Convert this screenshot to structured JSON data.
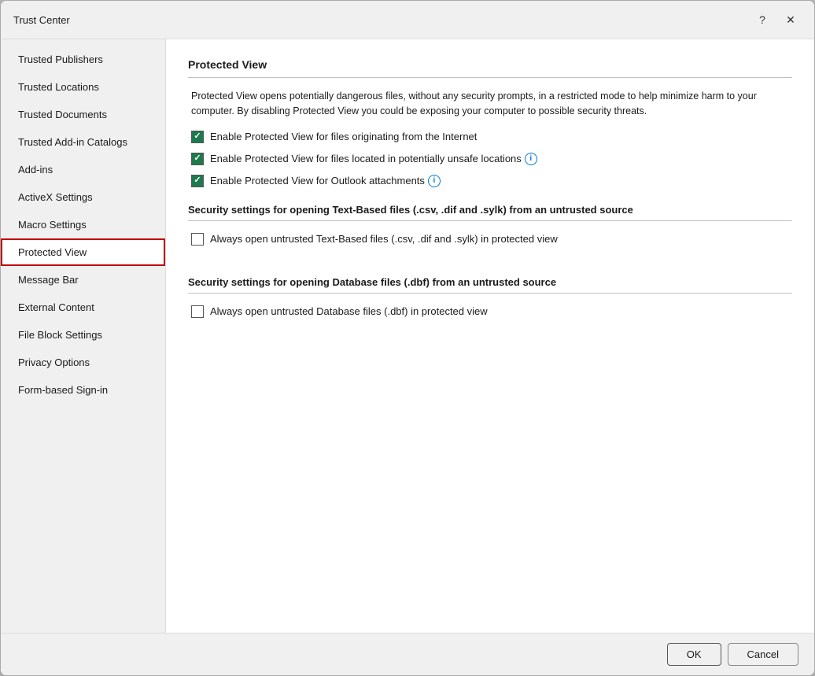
{
  "dialog": {
    "title": "Trust Center",
    "help_btn": "?",
    "close_btn": "✕"
  },
  "sidebar": {
    "items": [
      {
        "id": "trusted-publishers",
        "label": "Trusted Publishers",
        "active": false
      },
      {
        "id": "trusted-locations",
        "label": "Trusted Locations",
        "active": false
      },
      {
        "id": "trusted-documents",
        "label": "Trusted Documents",
        "active": false
      },
      {
        "id": "trusted-add-in-catalogs",
        "label": "Trusted Add-in Catalogs",
        "active": false
      },
      {
        "id": "add-ins",
        "label": "Add-ins",
        "active": false
      },
      {
        "id": "activex-settings",
        "label": "ActiveX Settings",
        "active": false
      },
      {
        "id": "macro-settings",
        "label": "Macro Settings",
        "active": false
      },
      {
        "id": "protected-view",
        "label": "Protected View",
        "active": true
      },
      {
        "id": "message-bar",
        "label": "Message Bar",
        "active": false
      },
      {
        "id": "external-content",
        "label": "External Content",
        "active": false
      },
      {
        "id": "file-block-settings",
        "label": "File Block Settings",
        "active": false
      },
      {
        "id": "privacy-options",
        "label": "Privacy Options",
        "active": false
      },
      {
        "id": "form-based-sign-in",
        "label": "Form-based Sign-in",
        "active": false
      }
    ]
  },
  "main": {
    "page_title": "Protected View",
    "description": "Protected View opens potentially dangerous files, without any security prompts, in a restricted mode to help minimize harm to your computer. By disabling Protected View you could be exposing your computer to possible security threats.",
    "checkboxes": [
      {
        "id": "cb-internet",
        "checked": true,
        "label": "Enable Protected View for files originating from the Internet",
        "has_info": false
      },
      {
        "id": "cb-unsafe-locations",
        "checked": true,
        "label": "Enable Protected View for files located in potentially unsafe locations",
        "has_info": true
      },
      {
        "id": "cb-outlook",
        "checked": true,
        "label": "Enable Protected View for Outlook attachments",
        "has_info": true
      }
    ],
    "text_based_section": {
      "title": "Security settings for opening Text-Based files (.csv, .dif and .sylk) from an untrusted source",
      "checkbox_label": "Always open untrusted Text-Based files (.csv, .dif and .sylk) in protected view",
      "checked": false
    },
    "database_section": {
      "title": "Security settings for opening Database files (.dbf) from an untrusted source",
      "checkbox_label": "Always open untrusted Database files (.dbf) in protected view",
      "checked": false
    }
  },
  "footer": {
    "ok_label": "OK",
    "cancel_label": "Cancel"
  }
}
